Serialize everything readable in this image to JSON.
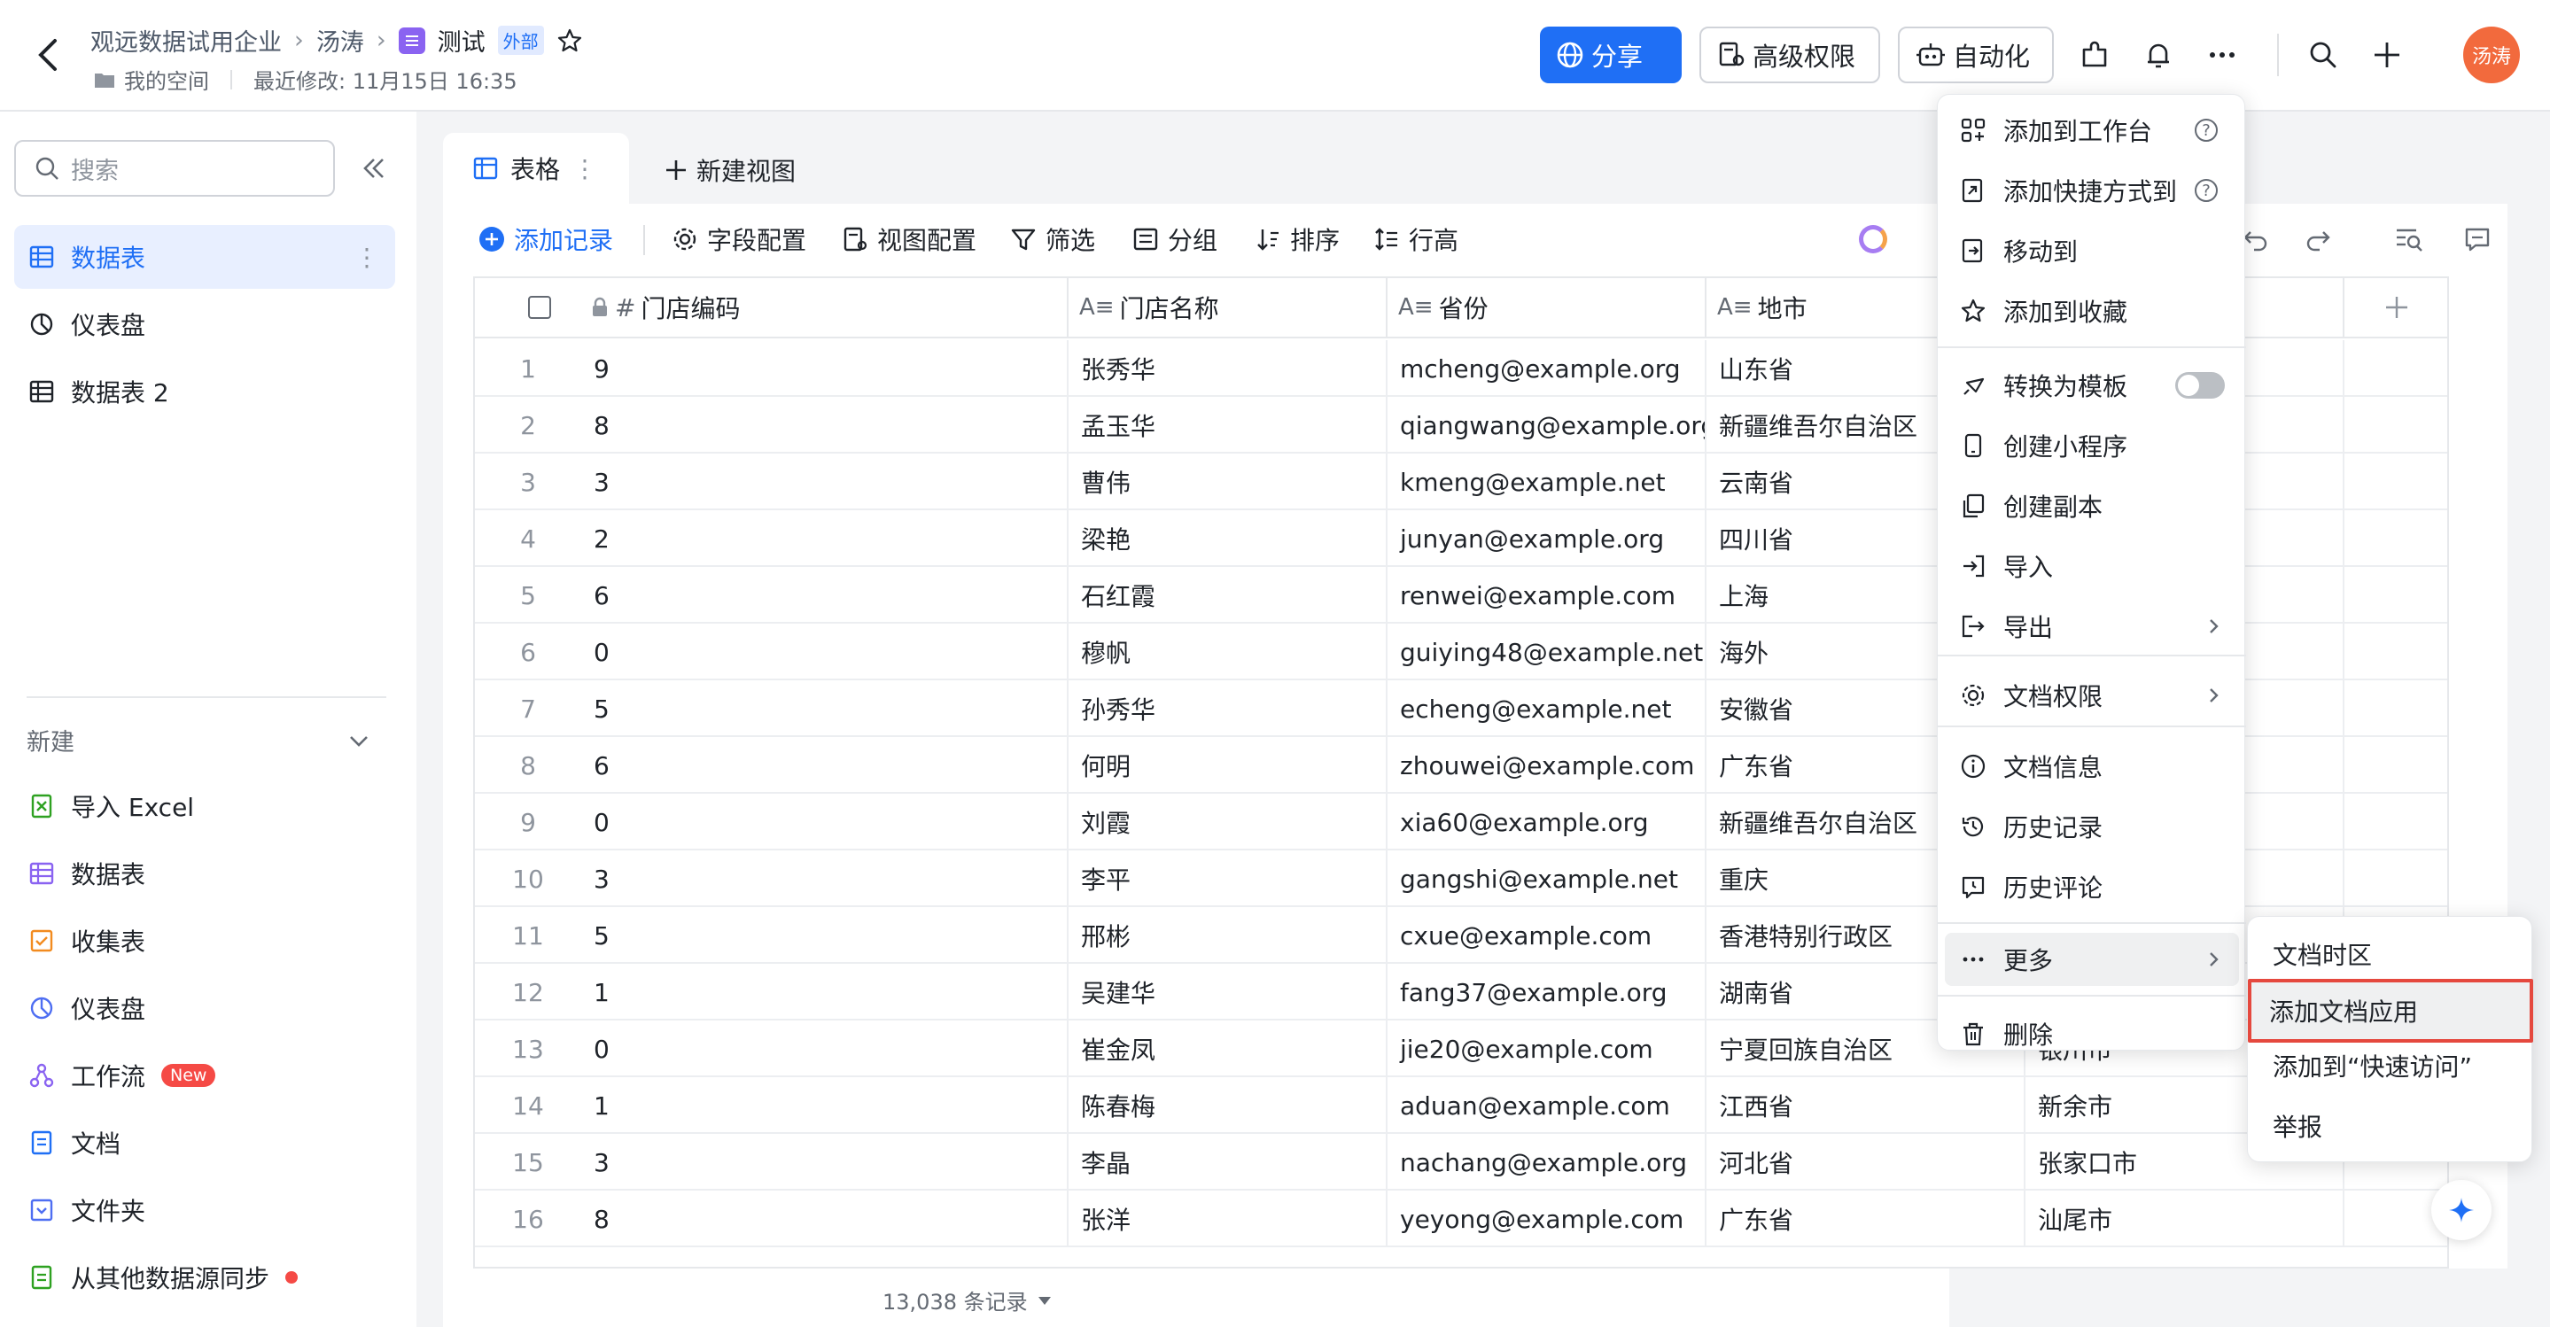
{
  "header": {
    "breadcrumb": [
      "观远数据试用企业",
      "汤涛",
      "测试"
    ],
    "external_tag": "外部",
    "space": "我的空间",
    "modified": "最近修改: 11月15日 16:35",
    "share": "分享",
    "advanced_permission": "高级权限",
    "automation": "自动化",
    "avatar_text": "汤涛"
  },
  "sidebar": {
    "search_placeholder": "搜索",
    "items": [
      {
        "label": "数据表"
      },
      {
        "label": "仪表盘"
      },
      {
        "label": "数据表 2"
      }
    ],
    "new_section": "新建",
    "new_items": [
      {
        "label": "导入 Excel"
      },
      {
        "label": "数据表"
      },
      {
        "label": "收集表"
      },
      {
        "label": "仪表盘"
      },
      {
        "label": "工作流"
      },
      {
        "label": "文档"
      },
      {
        "label": "文件夹"
      },
      {
        "label": "从其他数据源同步"
      }
    ],
    "new_badge": "New"
  },
  "tabs": {
    "table": "表格",
    "new_view": "新建视图"
  },
  "toolbar": {
    "add_record": "添加记录",
    "field_config": "字段配置",
    "view_config": "视图配置",
    "filter": "筛选",
    "group": "分组",
    "sort": "排序",
    "row_height": "行高"
  },
  "table": {
    "columns": [
      "门店编码",
      "门店名称",
      "省份",
      "地市"
    ],
    "rows": [
      {
        "n": "1",
        "code": "9",
        "name": "张秀华",
        "email": "mcheng@example.org",
        "prov": "山东省",
        "city": ""
      },
      {
        "n": "2",
        "code": "8",
        "name": "孟玉华",
        "email": "qiangwang@example.org",
        "prov": "新疆维吾尔自治区",
        "city": ""
      },
      {
        "n": "3",
        "code": "3",
        "name": "曹伟",
        "email": "kmeng@example.net",
        "prov": "云南省",
        "city": ""
      },
      {
        "n": "4",
        "code": "2",
        "name": "梁艳",
        "email": "junyan@example.org",
        "prov": "四川省",
        "city": ""
      },
      {
        "n": "5",
        "code": "6",
        "name": "石红霞",
        "email": "renwei@example.com",
        "prov": "上海",
        "city": ""
      },
      {
        "n": "6",
        "code": "0",
        "name": "穆帆",
        "email": "guiying48@example.net",
        "prov": "海外",
        "city": ""
      },
      {
        "n": "7",
        "code": "5",
        "name": "孙秀华",
        "email": "echeng@example.net",
        "prov": "安徽省",
        "city": ""
      },
      {
        "n": "8",
        "code": "6",
        "name": "何明",
        "email": "zhouwei@example.com",
        "prov": "广东省",
        "city": ""
      },
      {
        "n": "9",
        "code": "0",
        "name": "刘霞",
        "email": "xia60@example.org",
        "prov": "新疆维吾尔自治区",
        "city": ""
      },
      {
        "n": "10",
        "code": "3",
        "name": "李平",
        "email": "gangshi@example.net",
        "prov": "重庆",
        "city": ""
      },
      {
        "n": "11",
        "code": "5",
        "name": "邢彬",
        "email": "cxue@example.com",
        "prov": "香港特别行政区",
        "city": ""
      },
      {
        "n": "12",
        "code": "1",
        "name": "吴建华",
        "email": "fang37@example.org",
        "prov": "湖南省",
        "city": ""
      },
      {
        "n": "13",
        "code": "0",
        "name": "崔金凤",
        "email": "jie20@example.com",
        "prov": "宁夏回族自治区",
        "city": "银川市"
      },
      {
        "n": "14",
        "code": "1",
        "name": "陈春梅",
        "email": "aduan@example.com",
        "prov": "江西省",
        "city": "新余市"
      },
      {
        "n": "15",
        "code": "3",
        "name": "李晶",
        "email": "nachang@example.org",
        "prov": "河北省",
        "city": "张家口市"
      },
      {
        "n": "16",
        "code": "8",
        "name": "张洋",
        "email": "yeyong@example.com",
        "prov": "广东省",
        "city": "汕尾市"
      }
    ],
    "record_count": "13,038 条记录"
  },
  "menu": {
    "items": [
      "添加到工作台",
      "添加快捷方式到",
      "移动到",
      "添加到收藏",
      "转换为模板",
      "创建小程序",
      "创建副本",
      "导入",
      "导出",
      "文档权限",
      "文档信息",
      "历史记录",
      "历史评论",
      "更多",
      "删除"
    ]
  },
  "submenu": {
    "items": [
      "文档时区",
      "添加文档应用",
      "添加到“快速访问”",
      "举报"
    ]
  },
  "colors": {
    "accent": "#1f6ff5",
    "highlight_border": "#e5483e"
  }
}
